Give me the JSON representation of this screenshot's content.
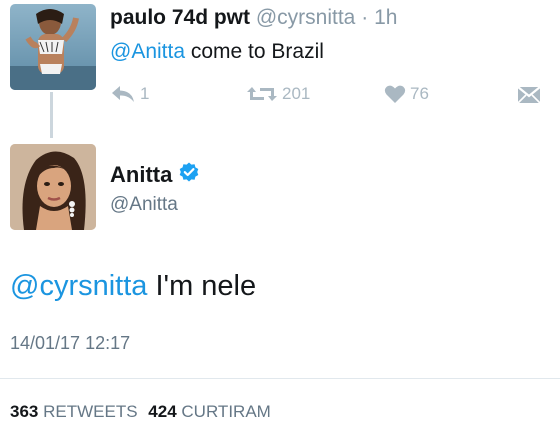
{
  "reply_tweet": {
    "display_name": "paulo 74d pwt",
    "handle": "@cyrsnitta",
    "separator": "·",
    "time": "1h",
    "mention": "@Anitta",
    "text": " come to Brazil",
    "actions": {
      "reply_count": "1",
      "retweet_count": "201",
      "like_count": "76"
    }
  },
  "main_tweet": {
    "display_name": "Anitta",
    "handle": "@Anitta",
    "verified": true,
    "mention": "@cyrsnitta",
    "text": " I'm nele",
    "date": "14/01/17 12:17",
    "stats": {
      "retweets_count": "363",
      "retweets_label": "RETWEETS",
      "likes_count": "424",
      "likes_label": "CURTIRAM"
    }
  },
  "colors": {
    "link": "#1b95e0",
    "muted": "#8899a6",
    "action_icon": "#aab8c2",
    "verified": "#1da1f2"
  },
  "icons": [
    "reply-icon",
    "retweet-icon",
    "heart-icon",
    "direct-message-icon",
    "verified-badge-icon"
  ]
}
